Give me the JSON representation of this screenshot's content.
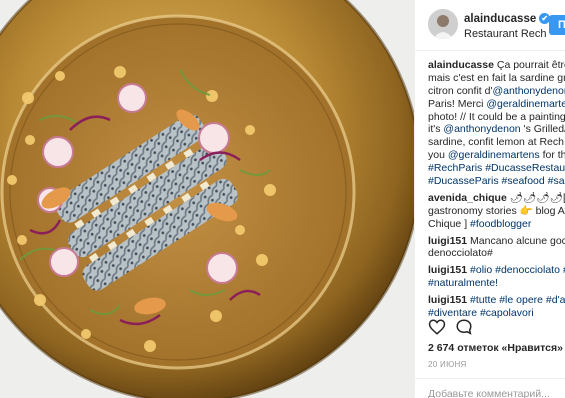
{
  "post": {
    "username": "alainducasse",
    "location": "Restaurant Rech",
    "follow_label": "П",
    "verified_glyph": "✔",
    "caption_lines": [
      {
        "parts": [
          {
            "t": "alainducasse",
            "c": "b"
          },
          {
            "t": " Ça pourrait être un",
            "c": ""
          }
        ]
      },
      {
        "parts": [
          {
            "t": "mais c'est en fait la sardine grillé",
            "c": ""
          }
        ]
      },
      {
        "parts": [
          {
            "t": "citron confit d'",
            "c": ""
          },
          {
            "t": "@anthonydenon",
            "c": "lk"
          },
          {
            "t": " c",
            "c": ""
          }
        ]
      },
      {
        "parts": [
          {
            "t": "Paris! Merci ",
            "c": ""
          },
          {
            "t": "@geraldinemartens",
            "c": "lk"
          }
        ]
      },
      {
        "parts": [
          {
            "t": "photo! // It could be a painting b",
            "c": ""
          }
        ]
      },
      {
        "parts": [
          {
            "t": "it's ",
            "c": ""
          },
          {
            "t": "@anthonydenon",
            "c": "lk"
          },
          {
            "t": " 's Grilled/m",
            "c": ""
          }
        ]
      },
      {
        "parts": [
          {
            "t": "sardine, confit lemon at Rech Par",
            "c": ""
          }
        ]
      },
      {
        "parts": [
          {
            "t": "you ",
            "c": ""
          },
          {
            "t": "@geraldinemartens",
            "c": "lk"
          },
          {
            "t": " for this",
            "c": ""
          }
        ]
      },
      {
        "parts": [
          {
            "t": "#RechParis #DucasseRestaurant",
            "c": "lk"
          }
        ]
      },
      {
        "parts": [
          {
            "t": "#DucasseParis #seafood #sardin",
            "c": "lk"
          }
        ]
      }
    ],
    "comments": [
      {
        "lines": [
          {
            "parts": [
              {
                "t": "avenida_chique",
                "c": "b"
              },
              {
                "t": " 🌶🌶🌶🌶[Cur",
                "c": ""
              }
            ]
          },
          {
            "parts": [
              {
                "t": "gastronomy stories 👉 blog Ave",
                "c": ""
              }
            ]
          },
          {
            "parts": [
              {
                "t": "Chique ] ",
                "c": ""
              },
              {
                "t": "#foodblogger",
                "c": "lk"
              }
            ]
          }
        ]
      },
      {
        "lines": [
          {
            "parts": [
              {
                "t": "luigi151",
                "c": "b"
              },
              {
                "t": " Mancano alcune gocce d",
                "c": ""
              }
            ]
          },
          {
            "parts": [
              {
                "t": "denocciolato#",
                "c": ""
              }
            ]
          }
        ]
      },
      {
        "lines": [
          {
            "parts": [
              {
                "t": "luigi151",
                "c": "b"
              },
              {
                "t": " ",
                "c": ""
              },
              {
                "t": "#olio #denocciolato #ex",
                "c": "lk"
              }
            ]
          },
          {
            "parts": [
              {
                "t": "#naturalmente!",
                "c": "lk"
              }
            ]
          }
        ]
      },
      {
        "lines": [
          {
            "parts": [
              {
                "t": "luigi151",
                "c": "b"
              },
              {
                "t": " ",
                "c": ""
              },
              {
                "t": "#tutte #le opere #d'arte",
                "c": "lk"
              }
            ]
          },
          {
            "parts": [
              {
                "t": "#diventare #capolavori",
                "c": "lk"
              }
            ]
          }
        ]
      }
    ],
    "likes": "2 674 отметок «Нравится»",
    "date": "20 ИЮНЯ",
    "add_comment_placeholder": "Добавьте комментарий..."
  },
  "colors": {
    "accent": "#3897f0",
    "link": "#003569",
    "text": "#262626",
    "muted": "#999999",
    "plate_gold": "#b8862f"
  },
  "icons": [
    "heart-icon",
    "comment-icon",
    "verified-badge-icon"
  ]
}
